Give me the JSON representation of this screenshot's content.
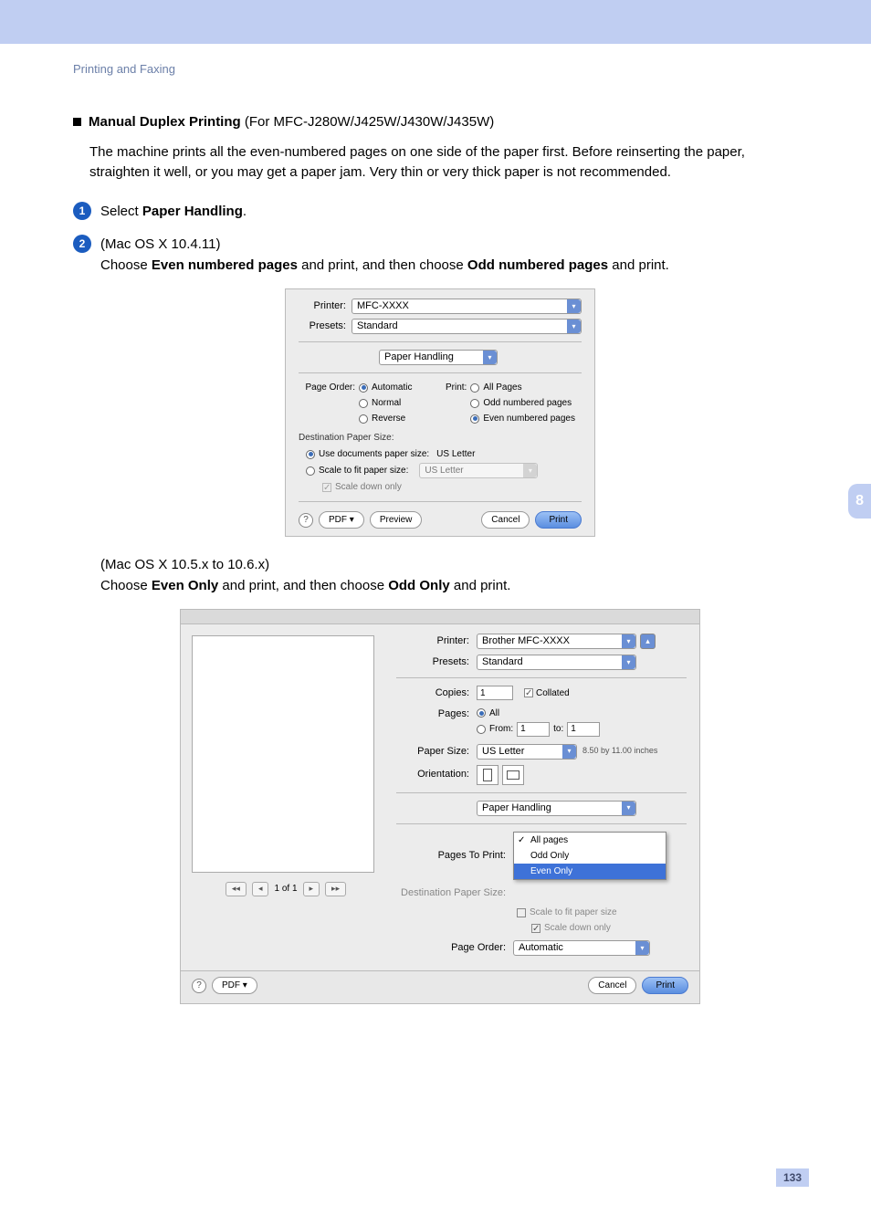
{
  "header": {
    "breadcrumb": "Printing and Faxing"
  },
  "title": {
    "heading": "Manual Duplex Printing",
    "models": " (For MFC-J280W/J425W/J430W/J435W)"
  },
  "intro": "The machine prints all the even-numbered pages on one side of the paper first. Before reinserting the paper, straighten it well, or you may get a paper jam. Very thin or very thick paper is not recommended.",
  "step1": {
    "pre": "Select ",
    "bold": "Paper Handling",
    "post": "."
  },
  "step2": {
    "os1": "(Mac OS X 10.4.11)",
    "line1_a": "Choose ",
    "line1_b": "Even numbered pages",
    "line1_c": " and print, and then choose ",
    "line1_d": "Odd numbered pages",
    "line1_e": " and print.",
    "os2": "(Mac OS X 10.5.x to 10.6.x)",
    "line2_a": "Choose ",
    "line2_b": "Even Only",
    "line2_c": " and print, and then choose ",
    "line2_d": "Odd Only",
    "line2_e": " and print."
  },
  "dialog1": {
    "printer_label": "Printer:",
    "printer_value": "MFC-XXXX",
    "presets_label": "Presets:",
    "presets_value": "Standard",
    "panel_value": "Paper Handling",
    "page_order_label": "Page Order:",
    "po_auto": "Automatic",
    "po_normal": "Normal",
    "po_reverse": "Reverse",
    "print_label": "Print:",
    "pr_all": "All Pages",
    "pr_odd": "Odd numbered pages",
    "pr_even": "Even numbered pages",
    "dest_label": "Destination Paper Size:",
    "use_doc": "Use documents paper size:",
    "use_doc_val": "US Letter",
    "scale_fit": "Scale to fit paper size:",
    "scale_fit_val": "US Letter",
    "scale_down": "Scale down only",
    "pdf": "PDF ▾",
    "preview": "Preview",
    "cancel": "Cancel",
    "print": "Print"
  },
  "dialog2": {
    "printer_label": "Printer:",
    "printer_value": "Brother MFC-XXXX",
    "presets_label": "Presets:",
    "presets_value": "Standard",
    "copies_label": "Copies:",
    "copies_value": "1",
    "collated": "Collated",
    "pages_label": "Pages:",
    "pages_all": "All",
    "pages_from": "From:",
    "pages_from_val": "1",
    "pages_to": "to:",
    "pages_to_val": "1",
    "papersize_label": "Paper Size:",
    "papersize_value": "US Letter",
    "papersize_dim": "8.50 by 11.00 inches",
    "orientation_label": "Orientation:",
    "panel_value": "Paper Handling",
    "pages_to_print_label": "Pages To Print:",
    "menu_all": "All pages",
    "menu_odd": "Odd Only",
    "menu_even": "Even Only",
    "dest_label": "Destination Paper Size:",
    "scale_fit": "Scale to fit paper size",
    "scale_down": "Scale down only",
    "page_order_label": "Page Order:",
    "page_order_value": "Automatic",
    "nav": "1 of 1",
    "pdf": "PDF ▾",
    "cancel": "Cancel",
    "print": "Print"
  },
  "chapter_tab": "8",
  "page_number": "133"
}
